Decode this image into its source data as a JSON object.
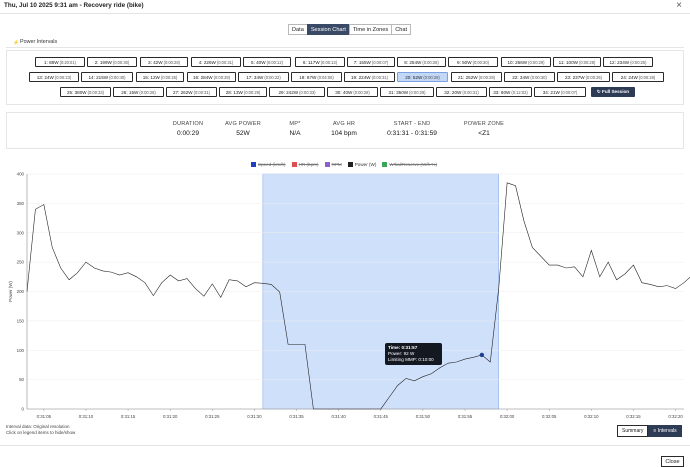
{
  "window": {
    "title": "Thu, Jul 10 2025 9:31 am - Recovery ride (bike)",
    "close_glyph": "×"
  },
  "tabs": [
    {
      "label": "Data",
      "active": false
    },
    {
      "label": "Session Chart",
      "active": true
    },
    {
      "label": "Time in Zones",
      "active": false
    },
    {
      "label": "Chat",
      "active": false
    }
  ],
  "panel": {
    "icon": "bolt-icon",
    "title": "Power Intervals"
  },
  "intervals": [
    {
      "label": "1: 88W",
      "time": "(0:20:01)"
    },
    {
      "label": "2: 199W",
      "time": "(0:00:30)"
    },
    {
      "label": "3: 42W",
      "time": "(0:00:28)"
    },
    {
      "label": "4: 226W",
      "time": "(0:00:31)"
    },
    {
      "label": "5: 40W",
      "time": "(0:00:12)"
    },
    {
      "label": "6: 117W",
      "time": "(0:00:13)"
    },
    {
      "label": "7: 155W",
      "time": "(0:00:07)"
    },
    {
      "label": "8: 254W",
      "time": "(0:00:28)"
    },
    {
      "label": "9: 50W",
      "time": "(0:00:30)"
    },
    {
      "label": "10: 266W",
      "time": "(0:00:29)"
    },
    {
      "label": "11: 100W",
      "time": "(0:00:28)"
    },
    {
      "label": "12: 234W",
      "time": "(0:00:25)"
    },
    {
      "label": "13: 24W",
      "time": "(0:00:23)"
    },
    {
      "label": "14: 215W",
      "time": "(0:00:40)"
    },
    {
      "label": "15: 12W",
      "time": "(0:00:26)"
    },
    {
      "label": "16: 284W",
      "time": "(0:00:29)"
    },
    {
      "label": "17: 34W",
      "time": "(0:00:22)"
    },
    {
      "label": "18: 87W",
      "time": "(0:04:06)"
    },
    {
      "label": "19: 224W",
      "time": "(0:00:31)"
    },
    {
      "label": "20: 52W",
      "time": "(0:00:29)",
      "selected": true
    },
    {
      "label": "21: 252W",
      "time": "(0:00:29)"
    },
    {
      "label": "22: 34W",
      "time": "(0:00:30)"
    },
    {
      "label": "23: 237W",
      "time": "(0:00:25)"
    },
    {
      "label": "24: 24W",
      "time": "(0:00:28)"
    },
    {
      "label": "25: 380W",
      "time": "(0:00:33)"
    },
    {
      "label": "26: 15W",
      "time": "(0:00:28)"
    },
    {
      "label": "27: 262W",
      "time": "(0:00:31)"
    },
    {
      "label": "28: 13W",
      "time": "(0:00:29)"
    },
    {
      "label": "29: 242W",
      "time": "(0:00:33)"
    },
    {
      "label": "30: 40W",
      "time": "(0:00:28)"
    },
    {
      "label": "31: 350W",
      "time": "(0:00:29)"
    },
    {
      "label": "32: 20W",
      "time": "(0:00:31)"
    },
    {
      "label": "33: 60W",
      "time": "(0:12:02)"
    },
    {
      "label": "34: 21W",
      "time": "(0:00:07)"
    }
  ],
  "full_session_label": "↻ Full Session",
  "stats": [
    {
      "label": "DURATION",
      "value": "0:00:29"
    },
    {
      "label": "AVG POWER",
      "value": "52W"
    },
    {
      "label": "MP*",
      "value": "N/A"
    },
    {
      "label": "AVG HR",
      "value": "104 bpm"
    },
    {
      "label": "START - END",
      "value": "0:31:31 - 0:31:59"
    },
    {
      "label": "POWER ZONE",
      "value": "<Z1"
    }
  ],
  "legend": [
    {
      "name": "Speed (km/h)",
      "color": "#1f3fbf",
      "hidden": true
    },
    {
      "name": "HR (bpm)",
      "color": "#e05050",
      "hidden": true
    },
    {
      "name": "RPM",
      "color": "#8b5fcf",
      "hidden": true
    },
    {
      "name": "Power (W)",
      "color": "#222222",
      "hidden": false
    },
    {
      "name": "W'bal/Reserve (W/h %)",
      "color": "#3aa65a",
      "hidden": true
    }
  ],
  "tooltip": {
    "time": "Time: 0:31:57",
    "power": "Power: 92 W",
    "mmp": "Limiting MMP: 0:10:00"
  },
  "footnote": {
    "line1": "Interval data: Original resolution",
    "line2": "Click on legend items to hide/show"
  },
  "view_toggle": {
    "summary": "Summary",
    "intervals": "≡ Intervals"
  },
  "close_label": "Close",
  "chart_data": {
    "type": "line",
    "ylabel": "Power (W)",
    "ylim": [
      0,
      400
    ],
    "yticks": [
      0,
      50,
      100,
      150,
      200,
      250,
      300,
      350,
      400
    ],
    "xlim": [
      1863,
      1941
    ],
    "xticks": [
      "0:31:05",
      "0:31:10",
      "0:31:15",
      "0:31:20",
      "0:31:25",
      "0:31:30",
      "0:31:35",
      "0:31:40",
      "0:31:45",
      "0:31:50",
      "0:31:55",
      "0:32:00",
      "0:32:05",
      "0:32:10",
      "0:32:15",
      "0:32:20",
      "0:32:25"
    ],
    "highlight_range": [
      "0:31:31",
      "0:31:59"
    ],
    "series": [
      {
        "name": "Power (W)",
        "color": "#222222",
        "x": [
          "0:31:03",
          "0:31:04",
          "0:31:05",
          "0:31:06",
          "0:31:07",
          "0:31:08",
          "0:31:09",
          "0:31:10",
          "0:31:11",
          "0:31:12",
          "0:31:13",
          "0:31:14",
          "0:31:15",
          "0:31:16",
          "0:31:17",
          "0:31:18",
          "0:31:19",
          "0:31:20",
          "0:31:21",
          "0:31:22",
          "0:31:23",
          "0:31:24",
          "0:31:25",
          "0:31:26",
          "0:31:27",
          "0:31:28",
          "0:31:29",
          "0:31:30",
          "0:31:31",
          "0:31:32",
          "0:31:33",
          "0:31:34",
          "0:31:35",
          "0:31:36",
          "0:31:37",
          "0:31:38",
          "0:31:39",
          "0:31:40",
          "0:31:41",
          "0:31:42",
          "0:31:43",
          "0:31:44",
          "0:31:45",
          "0:31:46",
          "0:31:47",
          "0:31:48",
          "0:31:49",
          "0:31:50",
          "0:31:51",
          "0:31:52",
          "0:31:53",
          "0:31:54",
          "0:31:55",
          "0:31:56",
          "0:31:57",
          "0:31:58",
          "0:31:59",
          "0:32:00",
          "0:32:01",
          "0:32:02",
          "0:32:03",
          "0:32:04",
          "0:32:05",
          "0:32:06",
          "0:32:07",
          "0:32:08",
          "0:32:09",
          "0:32:10",
          "0:32:11",
          "0:32:12",
          "0:32:13",
          "0:32:14",
          "0:32:15",
          "0:32:16",
          "0:32:17",
          "0:32:18",
          "0:32:19",
          "0:32:20",
          "0:32:21",
          "0:32:22",
          "0:32:23",
          "0:32:24",
          "0:32:25",
          "0:32:26",
          "0:32:27",
          "0:32:28",
          "0:32:29"
        ],
        "values": [
          200,
          340,
          348,
          275,
          240,
          220,
          232,
          250,
          240,
          235,
          233,
          228,
          232,
          225,
          215,
          193,
          215,
          228,
          218,
          222,
          205,
          192,
          213,
          190,
          220,
          218,
          208,
          215,
          214,
          212,
          199,
          110,
          110,
          110,
          0,
          0,
          0,
          0,
          0,
          0,
          0,
          0,
          0,
          20,
          40,
          52,
          48,
          55,
          60,
          70,
          78,
          80,
          85,
          88,
          92,
          80,
          205,
          385,
          380,
          320,
          275,
          260,
          245,
          245,
          240,
          242,
          225,
          270,
          225,
          250,
          220,
          230,
          245,
          215,
          212,
          208,
          210,
          205,
          215,
          228,
          240,
          210,
          228,
          220,
          235,
          225,
          220
        ]
      }
    ]
  }
}
